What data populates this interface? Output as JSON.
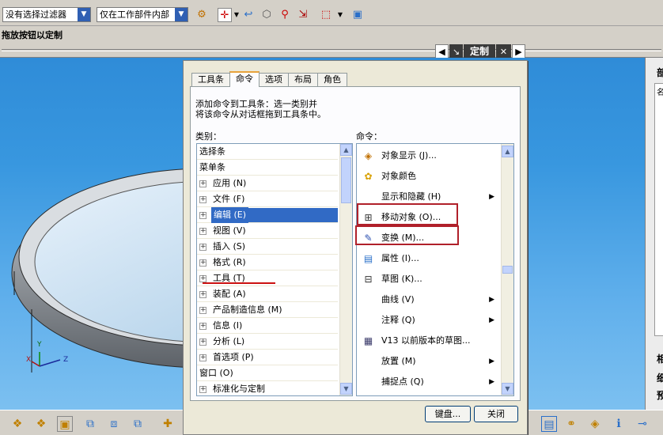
{
  "toolbar": {
    "filter_combo": "没有选择过滤器",
    "scope_combo": "仅在工作部件内部"
  },
  "drag_label": "拖放按钮以定制",
  "customize_bar": {
    "title": "定制"
  },
  "dialog": {
    "tabs": [
      "工具条",
      "命令",
      "选项",
      "布局",
      "角色"
    ],
    "instruction_line1": "添加命令到工具条：选一类别并",
    "instruction_line2": "将该命令从对话框拖到工具条中。",
    "category_label": "类别：",
    "command_label": "命令：",
    "categories": [
      {
        "label": "选择条",
        "expandable": false
      },
      {
        "label": "菜单条",
        "expandable": false
      },
      {
        "label": "应用 (N)",
        "expandable": true
      },
      {
        "label": "文件 (F)",
        "expandable": true
      },
      {
        "label": "编辑 (E)",
        "expandable": true,
        "selected": true
      },
      {
        "label": "视图 (V)",
        "expandable": true
      },
      {
        "label": "插入 (S)",
        "expandable": true
      },
      {
        "label": "格式 (R)",
        "expandable": true
      },
      {
        "label": "工具 (T)",
        "expandable": true
      },
      {
        "label": "装配 (A)",
        "expandable": true
      },
      {
        "label": "产品制造信息 (M)",
        "expandable": true
      },
      {
        "label": "信息 (I)",
        "expandable": true
      },
      {
        "label": "分析 (L)",
        "expandable": true
      },
      {
        "label": "首选项 (P)",
        "expandable": true
      },
      {
        "label": "窗口 (O)",
        "expandable": false
      },
      {
        "label": "标准化与定制",
        "expandable": true
      }
    ],
    "commands": [
      {
        "label": "对象显示 (J)...",
        "icon": "object-display-icon",
        "glyph": "◈",
        "submenu": false
      },
      {
        "label": "对象颜色",
        "icon": "object-color-icon",
        "glyph": "✿",
        "submenu": false
      },
      {
        "label": "显示和隐藏 (H)",
        "icon": "",
        "glyph": "",
        "submenu": true
      },
      {
        "label": "移动对象 (O)...",
        "icon": "move-object-icon",
        "glyph": "⊞",
        "submenu": false
      },
      {
        "label": "变换 (M)...",
        "icon": "transform-icon",
        "glyph": "✎",
        "submenu": false
      },
      {
        "label": "属性 (I)...",
        "icon": "properties-icon",
        "glyph": "▤",
        "submenu": false
      },
      {
        "label": "草图 (K)...",
        "icon": "sketch-icon",
        "glyph": "⊟",
        "submenu": false
      },
      {
        "label": "曲线 (V)",
        "icon": "",
        "glyph": "",
        "submenu": true
      },
      {
        "label": "注释 (Q)",
        "icon": "",
        "glyph": "",
        "submenu": true
      },
      {
        "label": "V13 以前版本的草图...",
        "icon": "legacy-sketch-icon",
        "glyph": "▦",
        "submenu": false
      },
      {
        "label": "放置 (M)",
        "icon": "",
        "glyph": "",
        "submenu": true
      },
      {
        "label": "捕捉点 (Q)",
        "icon": "",
        "glyph": "",
        "submenu": true
      }
    ],
    "keyboard_button": "键盘...",
    "close_button": "关闭"
  },
  "right_panel": {
    "items": [
      "部",
      "名",
      "相",
      "细",
      "预"
    ]
  },
  "axes": {
    "x": "X",
    "y": "Y",
    "z": "Z"
  }
}
